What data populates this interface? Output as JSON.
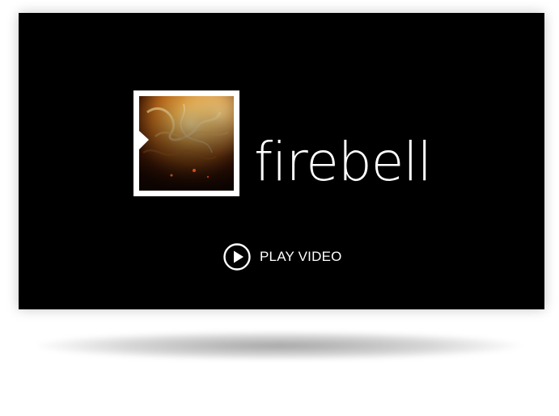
{
  "video": {
    "brand_name": "firebell",
    "play_label": "PLAY VIDEO",
    "play_icon": "play-circle-icon",
    "logo_icon": "fire-flame-logo"
  },
  "colors": {
    "frame_background": "#000000",
    "text": "#ffffff",
    "flame_bright": "#f0c060",
    "flame_mid": "#c98a2a",
    "flame_dark": "#3a1a06"
  }
}
